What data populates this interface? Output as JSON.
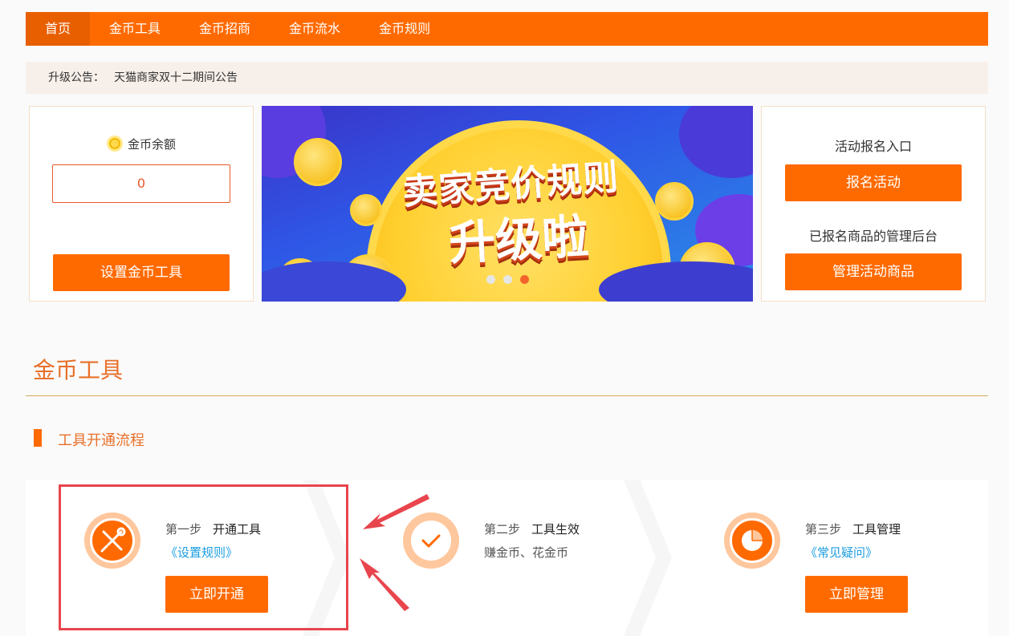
{
  "nav": {
    "items": [
      "首页",
      "金币工具",
      "金币招商",
      "金币流水",
      "金币规则"
    ],
    "active_index": 0
  },
  "notice": {
    "label": "升级公告：",
    "text": "天猫商家双十二期间公告"
  },
  "balance": {
    "title": "金币余额",
    "value": "0",
    "set_button": "设置金币工具"
  },
  "banner": {
    "line1": "卖家竞价规则",
    "line2": "升级啦",
    "slide_count": 3,
    "active_slide": 2
  },
  "activity": {
    "entry_title": "活动报名入口",
    "signup_button": "报名活动",
    "manage_title": "已报名商品的管理后台",
    "manage_button": "管理活动商品"
  },
  "section": {
    "title": "金币工具",
    "subtitle": "工具开通流程"
  },
  "steps": [
    {
      "step": "第一步",
      "name": "开通工具",
      "link": "《设置规则》",
      "button": "立即开通",
      "icon": "tools-icon"
    },
    {
      "step": "第二步",
      "name": "工具生效",
      "desc": "赚金币、花金币",
      "icon": "check-icon"
    },
    {
      "step": "第三步",
      "name": "工具管理",
      "link": "《常见疑问》",
      "button": "立即管理",
      "icon": "pie-chart-icon"
    }
  ],
  "colors": {
    "accent": "#ff6a00",
    "highlight": "#e8454d",
    "link": "#1a9de0"
  }
}
